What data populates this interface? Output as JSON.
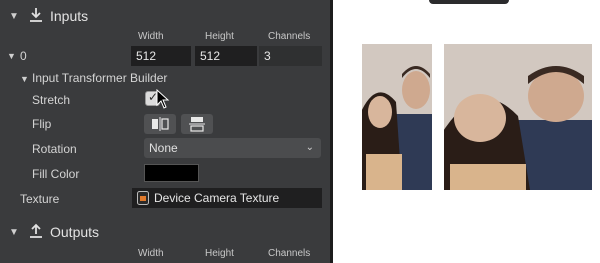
{
  "inputs_section": {
    "title": "Inputs",
    "icon": "download-icon"
  },
  "columns": {
    "width": "Width",
    "height": "Height",
    "channels": "Channels"
  },
  "input_0": {
    "label": "0",
    "width": "512",
    "height": "512",
    "channels": "3"
  },
  "transformer": {
    "title": "Input Transformer Builder",
    "stretch_label": "Stretch",
    "stretch_checked": true,
    "flip_label": "Flip",
    "rotation_label": "Rotation",
    "rotation_value": "None",
    "fill_color_label": "Fill Color",
    "fill_color": "#000000"
  },
  "texture": {
    "label": "Texture",
    "value": "Device Camera Texture"
  },
  "outputs_section": {
    "title": "Outputs",
    "icon": "upload-icon"
  },
  "output_columns": {
    "width": "Width",
    "height": "Height",
    "channels": "Channels"
  }
}
